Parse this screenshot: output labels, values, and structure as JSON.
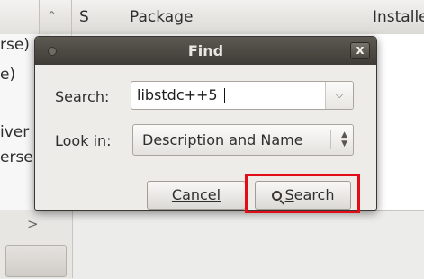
{
  "background_window": {
    "columns": {
      "sort_glyph": "^",
      "status": "S",
      "package": "Package",
      "installed": "Installe"
    },
    "left_fragments": [
      "rse)",
      "e)",
      "iver",
      "erse"
    ],
    "bottom_chevron": ">"
  },
  "dialog": {
    "title": "Find",
    "close_glyph": "x",
    "search_label": "Search:",
    "search_value": "libstdc++5",
    "look_in_label": "Look in:",
    "look_in_value": "Description and Name",
    "cancel_label": "Cancel",
    "search_button_label": "Search"
  },
  "colors": {
    "highlight": "#e20d17"
  }
}
